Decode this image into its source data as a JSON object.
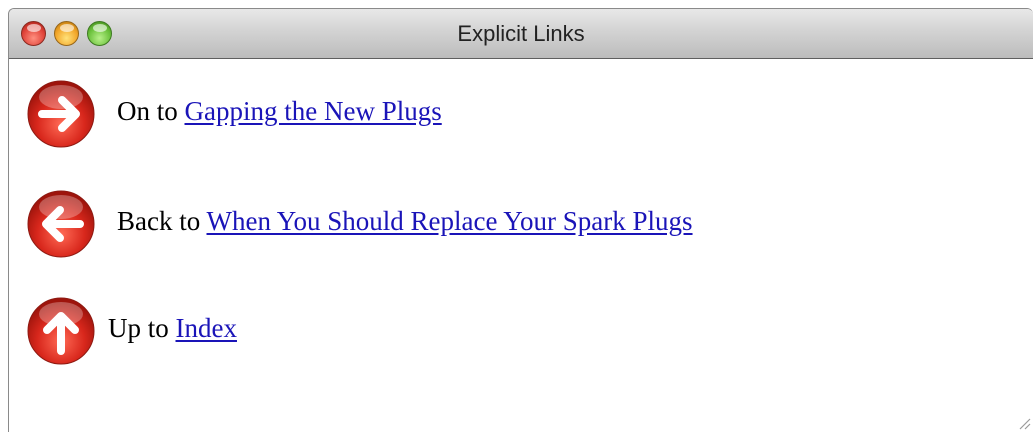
{
  "window": {
    "title": "Explicit Links"
  },
  "links": [
    {
      "icon": "arrow-right-icon",
      "prefix": "On to",
      "link_text": "Gapping the New Plugs"
    },
    {
      "icon": "arrow-left-icon",
      "prefix": "Back to",
      "link_text": "When You Should Replace Your Spark Plugs"
    },
    {
      "icon": "arrow-up-icon",
      "prefix": "Up to",
      "link_text": "Index"
    }
  ],
  "colors": {
    "link": "#1a14b8",
    "icon_red": "#d8271c"
  }
}
